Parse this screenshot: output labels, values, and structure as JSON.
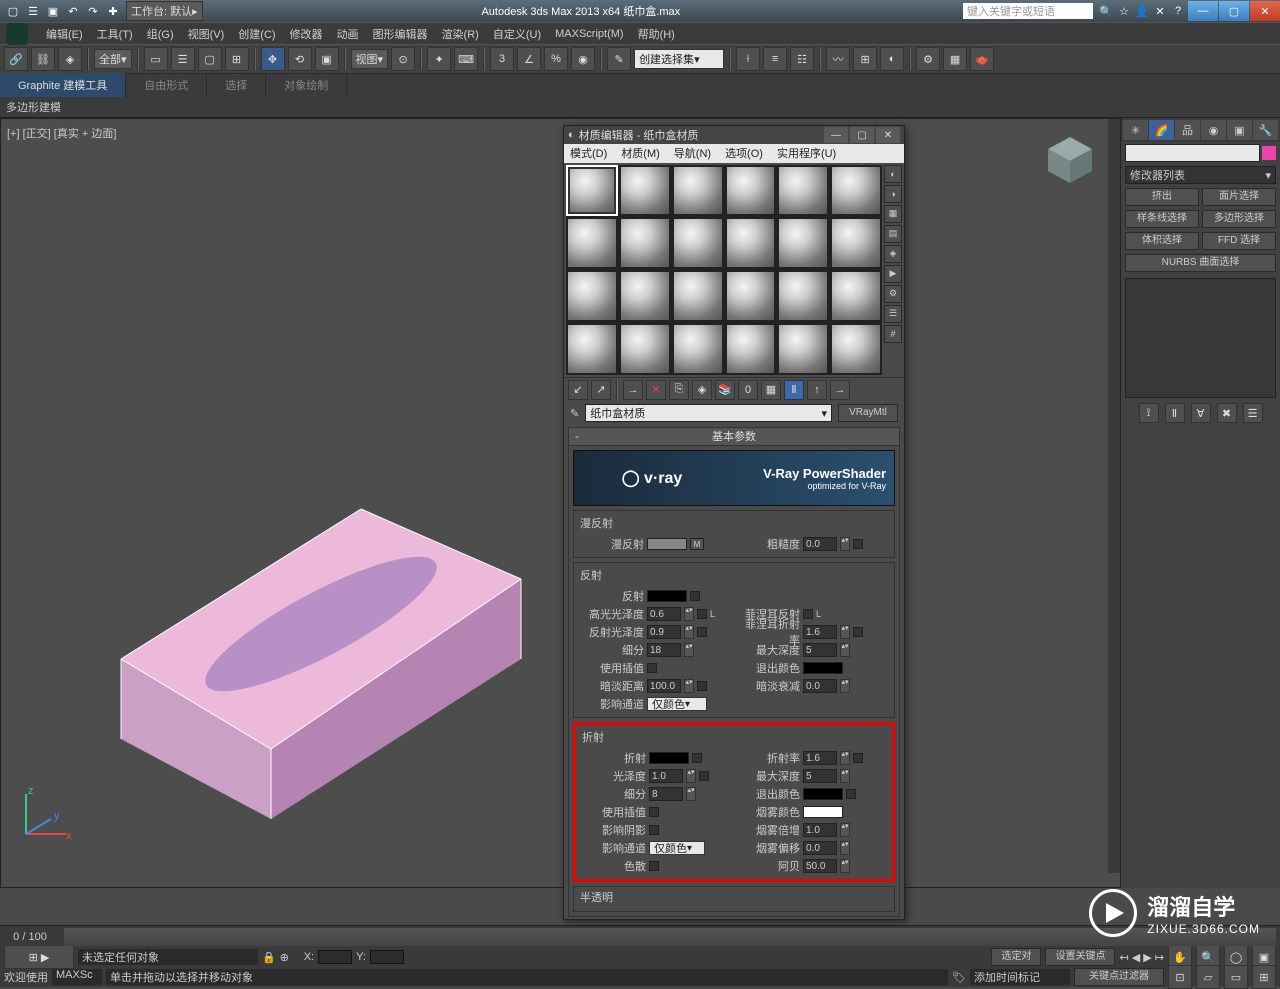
{
  "titlebar": {
    "workspace_label": "工作台: 默认",
    "app_title": "Autodesk 3ds Max  2013 x64    纸巾盒.max",
    "search_placeholder": "键入关键字或短语"
  },
  "menubar": [
    "编辑(E)",
    "工具(T)",
    "组(G)",
    "视图(V)",
    "创建(C)",
    "修改器",
    "动画",
    "图形编辑器",
    "渲染(R)",
    "自定义(U)",
    "MAXScript(M)",
    "帮助(H)"
  ],
  "toolbar": {
    "selfilter": "全部",
    "viewmode": "视图",
    "createsel": "创建选择集"
  },
  "ribbon_tabs": [
    "Graphite 建模工具",
    "自由形式",
    "选择",
    "对象绘制"
  ],
  "ribbon_sub": "多边形建模",
  "viewport_label": "[+] [正交] [真实 + 边面]",
  "timeline_label": "0 / 100",
  "cmd_panel": {
    "modlist": "修改器列表",
    "btns": [
      "挤出",
      "面片选择",
      "样条线选择",
      "多边形选择",
      "体积选择",
      "FFD 选择"
    ],
    "nurbs": "NURBS 曲面选择"
  },
  "mat_editor": {
    "title": "材质编辑器 - 纸巾盒材质",
    "menu": [
      "模式(D)",
      "材质(M)",
      "导航(N)",
      "选项(O)",
      "实用程序(U)"
    ],
    "mat_name": "纸巾盒材质",
    "mat_type": "VRayMtl",
    "rollup_basic": "基本参数",
    "vray_ps": "V-Ray PowerShader",
    "vray_opt": "optimized for V-Ray",
    "diffuse": {
      "grp": "漫反射",
      "lbl": "漫反射",
      "rough_lbl": "粗糙度",
      "rough": "0.0"
    },
    "reflect": {
      "grp": "反射",
      "refl_lbl": "反射",
      "hglgloss_lbl": "高光光泽度",
      "hglgloss": "0.6",
      "l": "L",
      "reflgloss_lbl": "反射光泽度",
      "reflgloss": "0.9",
      "subdiv_lbl": "细分",
      "subdiv": "18",
      "interp_lbl": "使用插值",
      "dimdist_lbl": "暗淡距离",
      "dimdist": "100.0",
      "affch_lbl": "影响通道",
      "affch": "仅颜色",
      "fresnel_lbl": "菲涅耳反射",
      "fresnelior_lbl": "菲涅耳折射率",
      "fresnelior": "1.6",
      "maxdep_lbl": "最大深度",
      "maxdep": "5",
      "exitcol_lbl": "退出颜色",
      "dimfall_lbl": "暗淡衰减",
      "dimfall": "0.0"
    },
    "refract": {
      "grp": "折射",
      "refr_lbl": "折射",
      "ior_lbl": "折射率",
      "ior": "1.6",
      "gloss_lbl": "光泽度",
      "gloss": "1.0",
      "maxdep_lbl": "最大深度",
      "maxdep": "5",
      "subdiv_lbl": "细分",
      "subdiv": "8",
      "exitcol_lbl": "退出颜色",
      "interp_lbl": "使用插值",
      "fogcol_lbl": "烟雾颜色",
      "affsh_lbl": "影响阴影",
      "fogmult_lbl": "烟雾倍增",
      "fogmult": "1.0",
      "affch_lbl": "影响通道",
      "affch": "仅颜色",
      "fogbias_lbl": "烟雾偏移",
      "fogbias": "0.0",
      "disp_lbl": "色散",
      "abbe_lbl": "阿贝",
      "abbe": "50.0"
    },
    "translucent": "半透明"
  },
  "statusbar": {
    "nosel": "未选定任何对象",
    "hint": "单击并拖动以选择并移动对象",
    "welcome": "欢迎使用",
    "maxs": "MAXSc",
    "addtime": "添加时间标记",
    "setkey": "设置关键点",
    "keyfilt": "关键点过滤器",
    "sel": "选定对"
  },
  "watermark": {
    "brand": "溜溜自学",
    "url": "ZIXUE.3D66.COM"
  }
}
